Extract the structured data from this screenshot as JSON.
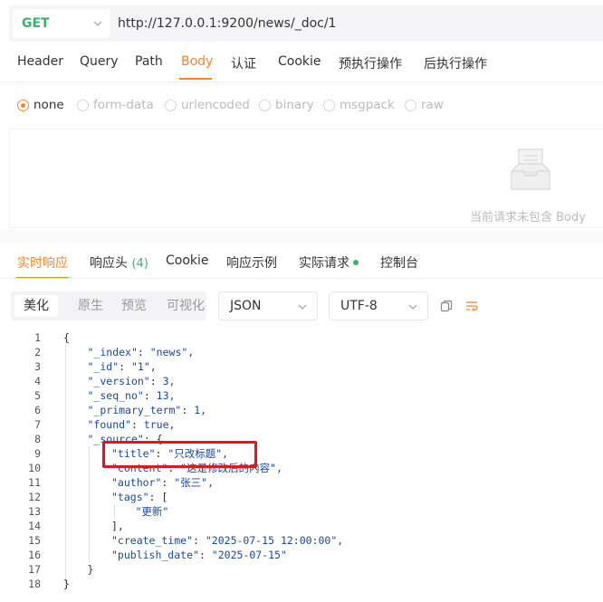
{
  "request": {
    "method": "GET",
    "url": "http://127.0.0.1:9200/news/_doc/1"
  },
  "request_tabs": [
    "Header",
    "Query",
    "Path",
    "Body",
    "认证",
    "Cookie",
    "预执行操作",
    "后执行操作"
  ],
  "active_request_tab": "Body",
  "body_types": [
    "none",
    "form-data",
    "urlencoded",
    "binary",
    "msgpack",
    "raw"
  ],
  "selected_body_type": "none",
  "empty_body_message": "当前请求未包含 Body",
  "response_tabs": {
    "live": "实时响应",
    "headers": "响应头",
    "headers_count": "(4)",
    "cookie": "Cookie",
    "examples": "响应示例",
    "actual": "实际请求",
    "console": "控制台"
  },
  "view_modes": [
    "美化",
    "原生",
    "预览",
    "可视化"
  ],
  "active_view_mode": "美化",
  "format_select": "JSON",
  "encoding_select": "UTF-8",
  "colors": {
    "accent": "#f5862d",
    "method_green": "#37b36b",
    "highlight_red": "#e8141b",
    "json_key": "#1a47a8"
  },
  "icons": [
    "chevron-down-icon",
    "inbox-empty-icon",
    "copy-icon",
    "wrap-lines-icon"
  ],
  "code": {
    "line_numbers": [
      "1",
      "2",
      "3",
      "4",
      "5",
      "6",
      "7",
      "8",
      "9",
      "10",
      "11",
      "12",
      "13",
      "14",
      "15",
      "16",
      "17",
      "18"
    ],
    "lines": [
      {
        "key": "",
        "value": "",
        "open": "{"
      },
      {
        "key": "\"_index\"",
        "value": "\"news\","
      },
      {
        "key": "\"_id\"",
        "value": "\"1\","
      },
      {
        "key": "\"_version\"",
        "value": "3,"
      },
      {
        "key": "\"_seq_no\"",
        "value": "13,"
      },
      {
        "key": "\"_primary_term\"",
        "value": "1,"
      },
      {
        "key": "\"found\"",
        "value": "true,"
      },
      {
        "key": "\"_source\"",
        "value": "{"
      },
      {
        "key": "\"title\"",
        "value": "\"只改标题\","
      },
      {
        "key": "\"content\"",
        "value": "\"这是修改后的内容\","
      },
      {
        "key": "\"author\"",
        "value": "\"张三\","
      },
      {
        "key": "\"tags\"",
        "value": "["
      },
      {
        "key": "",
        "value": "\"更新\""
      },
      {
        "key": "",
        "value": "],"
      },
      {
        "key": "\"create_time\"",
        "value": "\"2025-07-15 12:00:00\","
      },
      {
        "key": "\"publish_date\"",
        "value": "\"2025-07-15\""
      },
      {
        "key": "",
        "value": "}"
      },
      {
        "key": "",
        "value": "}"
      }
    ]
  }
}
